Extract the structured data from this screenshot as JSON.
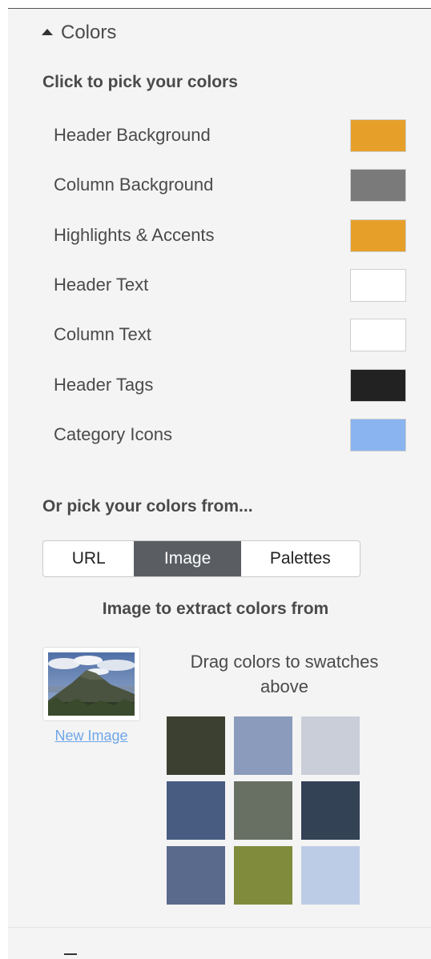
{
  "colors_section": {
    "title": "Colors",
    "expanded": true,
    "pick_heading": "Click to pick your colors",
    "rows": [
      {
        "label": "Header Background",
        "color": "#e6a02a"
      },
      {
        "label": "Column Background",
        "color": "#7a7a7a"
      },
      {
        "label": "Highlights & Accents",
        "color": "#e6a02a"
      },
      {
        "label": "Header Text",
        "color": "#ffffff"
      },
      {
        "label": "Column Text",
        "color": "#ffffff"
      },
      {
        "label": "Header Tags",
        "color": "#222222"
      },
      {
        "label": "Category Icons",
        "color": "#8ab4f0"
      }
    ]
  },
  "source_section": {
    "heading": "Or pick your colors from...",
    "tabs": [
      {
        "label": "URL",
        "active": false
      },
      {
        "label": "Image",
        "active": true
      },
      {
        "label": "Palettes",
        "active": false
      }
    ],
    "extract_title": "Image to extract colors from",
    "new_image_link": "New Image",
    "drag_hint": "Drag colors to swatches above",
    "extracted_colors": [
      "#3c4030",
      "#8a9bbb",
      "#c9ced8",
      "#485c82",
      "#687064",
      "#344256",
      "#5a6a8c",
      "#808c3c",
      "#bdcce6"
    ]
  }
}
